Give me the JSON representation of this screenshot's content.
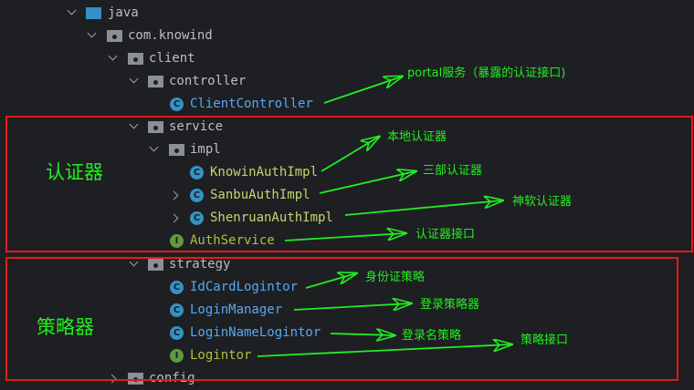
{
  "tree": {
    "java": "java",
    "pkg": "com.knowind",
    "client": "client",
    "controller": "controller",
    "client_controller": "ClientController",
    "service": "service",
    "impl": "impl",
    "knowin": "KnowinAuthImpl",
    "sanbu": "SanbuAuthImpl",
    "shenruan": "ShenruanAuthImpl",
    "auth_service": "AuthService",
    "strategy": "strategy",
    "idcard": "IdCardLogintor",
    "login_manager": "LoginManager",
    "login_name": "LoginNameLogintor",
    "logintor": "Logintor",
    "config": "config"
  },
  "icons": {
    "class_letter": "C",
    "interface_letter": "I"
  },
  "annotations": {
    "portal": "portal服务（暴露的认证接口)",
    "local_auth": "本地认证器",
    "sanbu_auth": "三部认证器",
    "shenruan_auth": "神软认证器",
    "auth_interface": "认证器接口",
    "idcard_strategy": "身份证策略",
    "login_strategy": "登录策略器",
    "login_name_strategy": "登录名策略",
    "strategy_interface": "策略接口"
  },
  "sections": {
    "authenticator": "认证器",
    "strategy": "策略器"
  },
  "colors": {
    "annotation": "#22ee22",
    "box": "#e41b1b",
    "background": "#1e1f22"
  }
}
